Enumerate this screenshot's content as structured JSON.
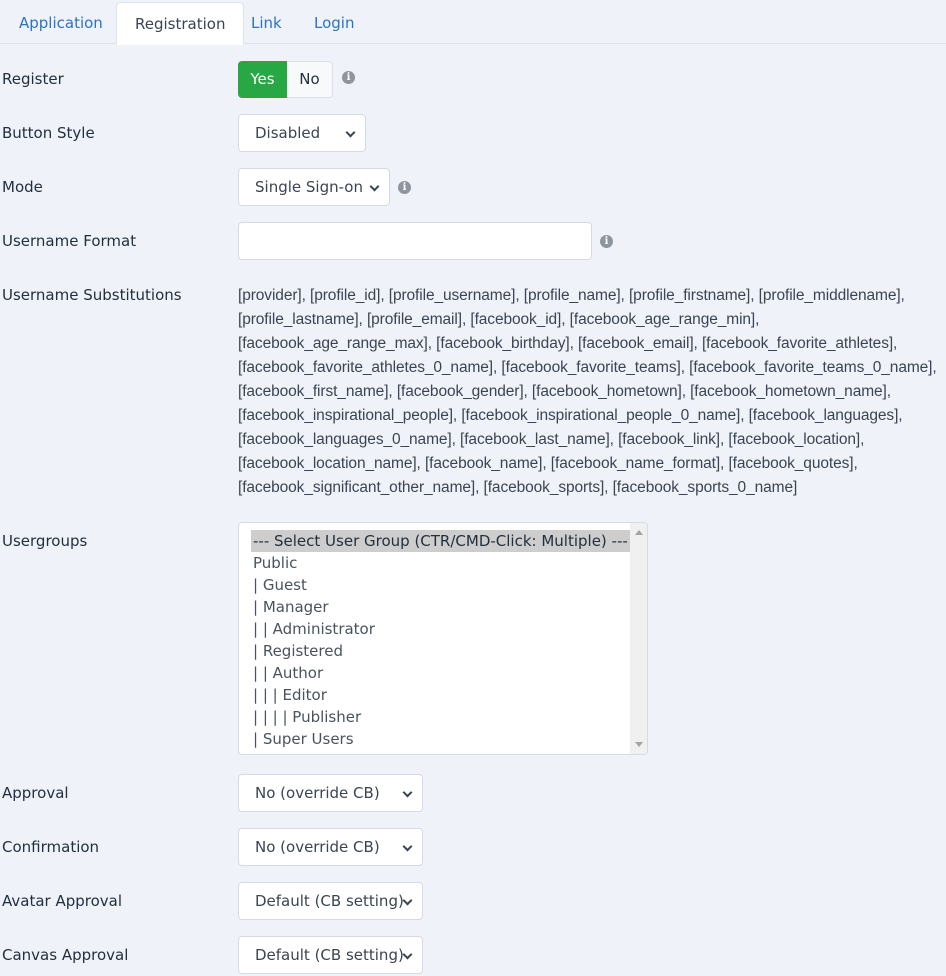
{
  "tabs": [
    {
      "label": "Application",
      "active": false
    },
    {
      "label": "Registration",
      "active": true
    },
    {
      "label": "Link",
      "active": false
    },
    {
      "label": "Login",
      "active": false
    }
  ],
  "fields": {
    "register": {
      "label": "Register",
      "yes_label": "Yes",
      "no_label": "No",
      "value": "Yes",
      "info_icon": "info-icon"
    },
    "button_style": {
      "label": "Button Style",
      "value": "Disabled"
    },
    "mode": {
      "label": "Mode",
      "value": "Single Sign-on",
      "info_icon": "info-icon"
    },
    "username_format": {
      "label": "Username Format",
      "value": "",
      "placeholder": "",
      "info_icon": "info-icon"
    },
    "username_substitutions": {
      "label": "Username Substitutions",
      "text": "[provider], [profile_id], [profile_username], [profile_name], [profile_firstname], [profile_middlename], [profile_lastname], [profile_email], [facebook_id], [facebook_age_range_min], [facebook_age_range_max], [facebook_birthday], [facebook_email], [facebook_favorite_athletes], [facebook_favorite_athletes_0_name], [facebook_favorite_teams], [facebook_favorite_teams_0_name], [facebook_first_name], [facebook_gender], [facebook_hometown], [facebook_hometown_name], [facebook_inspirational_people], [facebook_inspirational_people_0_name], [facebook_languages], [facebook_languages_0_name], [facebook_last_name], [facebook_link], [facebook_location], [facebook_location_name], [facebook_name], [facebook_name_format], [facebook_quotes], [facebook_significant_other_name], [facebook_sports], [facebook_sports_0_name]"
    },
    "usergroups": {
      "label": "Usergroups",
      "options": [
        "--- Select User Group (CTR/CMD-Click: Multiple) ---",
        "Public",
        "| Guest",
        "| Manager",
        "| | Administrator",
        "| Registered",
        "| | Author",
        "| | | Editor",
        "| | | | Publisher",
        "| Super Users"
      ],
      "selected_index": 0
    },
    "approval": {
      "label": "Approval",
      "value": "No (override CB)"
    },
    "confirmation": {
      "label": "Confirmation",
      "value": "No (override CB)"
    },
    "avatar_approval": {
      "label": "Avatar Approval",
      "value": "Default (CB setting)"
    },
    "canvas_approval": {
      "label": "Canvas Approval",
      "value": "Default (CB setting)"
    }
  },
  "colors": {
    "accent_green": "#28a745",
    "tab_link": "#2a73c5",
    "background": "#f0f2fa"
  }
}
